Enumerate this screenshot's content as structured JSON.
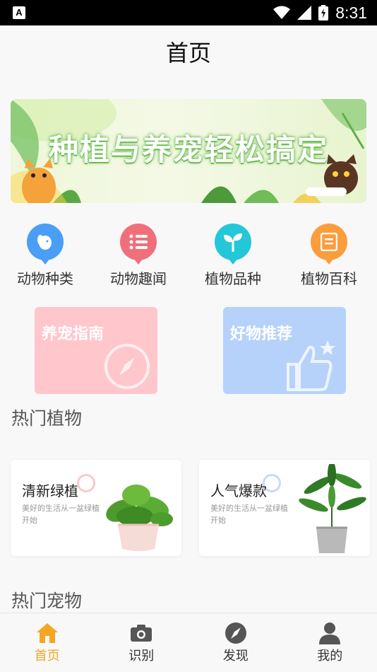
{
  "status_bar": {
    "time": "8:31"
  },
  "header": {
    "title": "首页"
  },
  "banner": {
    "slogan": "种植与养宠轻松搞定"
  },
  "quick_links": [
    {
      "label": "动物种类",
      "icon": "dog-icon",
      "color": "#4a9ef5"
    },
    {
      "label": "动物趣闻",
      "icon": "list-icon",
      "color": "#f06f7a"
    },
    {
      "label": "植物品种",
      "icon": "sprout-icon",
      "color": "#24c7d7"
    },
    {
      "label": "植物百科",
      "icon": "book-icon",
      "color": "#fb9d3c"
    }
  ],
  "feature_cards": [
    {
      "label": "养宠指南",
      "icon": "compass-icon",
      "color": "#ffc6cb"
    },
    {
      "label": "好物推荐",
      "icon": "thumbs-up-icon",
      "color": "#b6d2fb"
    }
  ],
  "sections": {
    "hot_plants": "热门植物",
    "hot_pets": "热门宠物"
  },
  "plant_cards": [
    {
      "title": "清新绿植",
      "subtitle": "美好的生活从一盆绿植开始"
    },
    {
      "title": "人气爆款",
      "subtitle": "美好的生活从一盆绿植开始"
    }
  ],
  "tabs": [
    {
      "label": "首页",
      "icon": "home-icon",
      "active": true
    },
    {
      "label": "识别",
      "icon": "camera-icon",
      "active": false
    },
    {
      "label": "发现",
      "icon": "compass-icon",
      "active": false
    },
    {
      "label": "我的",
      "icon": "user-icon",
      "active": false
    }
  ],
  "colors": {
    "accent": "#f5a623",
    "tab_inactive": "#555555"
  }
}
